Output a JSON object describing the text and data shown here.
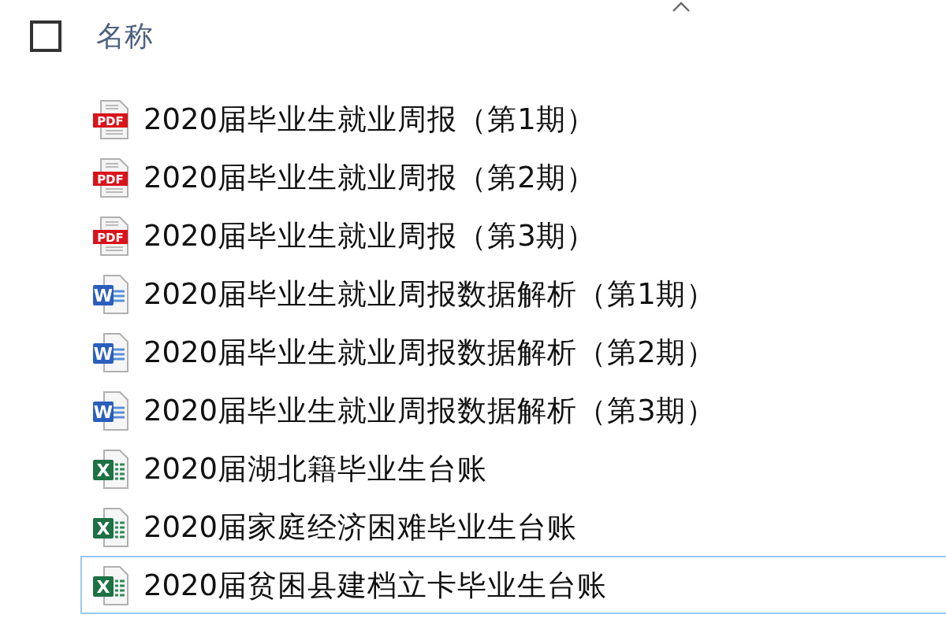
{
  "header": {
    "checked": false,
    "column": "名称",
    "sort_ascending": true
  },
  "files": [
    {
      "kind": "pdf",
      "icon_label": "PDF",
      "name": "2020届毕业生就业周报（第1期）",
      "focused": false
    },
    {
      "kind": "pdf",
      "icon_label": "PDF",
      "name": "2020届毕业生就业周报（第2期）",
      "focused": false
    },
    {
      "kind": "pdf",
      "icon_label": "PDF",
      "name": "2020届毕业生就业周报（第3期）",
      "focused": false
    },
    {
      "kind": "word",
      "icon_label": "W",
      "name": "2020届毕业生就业周报数据解析（第1期）",
      "focused": false
    },
    {
      "kind": "word",
      "icon_label": "W",
      "name": "2020届毕业生就业周报数据解析（第2期）",
      "focused": false
    },
    {
      "kind": "word",
      "icon_label": "W",
      "name": "2020届毕业生就业周报数据解析（第3期）",
      "focused": false
    },
    {
      "kind": "excel",
      "icon_label": "X",
      "name": "2020届湖北籍毕业生台账",
      "focused": false
    },
    {
      "kind": "excel",
      "icon_label": "X",
      "name": "2020届家庭经济困难毕业生台账",
      "focused": false
    },
    {
      "kind": "excel",
      "icon_label": "X",
      "name": "2020届贫困县建档立卡毕业生台账",
      "focused": true
    }
  ]
}
